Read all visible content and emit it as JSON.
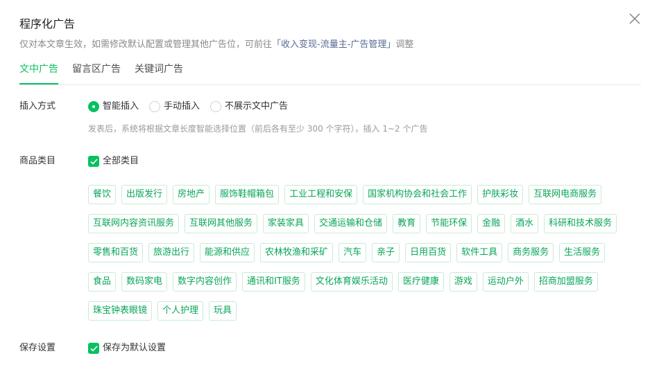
{
  "dialog": {
    "title": "程序化广告",
    "subtitle_prefix": "仅对本文章生效，如需修改默认配置或管理其他广告位，可前往",
    "subtitle_link": "「收入变现-流量主-广告管理」",
    "subtitle_suffix": "调整"
  },
  "tabs": [
    {
      "label": "文中广告",
      "active": true
    },
    {
      "label": "留言区广告",
      "active": false
    },
    {
      "label": "关键词广告",
      "active": false
    }
  ],
  "insert_mode": {
    "label": "插入方式",
    "options": [
      {
        "label": "智能插入",
        "selected": true
      },
      {
        "label": "手动插入",
        "selected": false
      },
      {
        "label": "不展示文中广告",
        "selected": false
      }
    ],
    "hint": "发表后，系统将根据文章长度智能选择位置（前后各有至少 300 个字符），插入 1~2 个广告"
  },
  "category": {
    "label": "商品类目",
    "all_label": "全部类目",
    "all_checked": true,
    "rows": [
      [
        "餐饮",
        "出版发行",
        "房地产",
        "服饰鞋帽箱包",
        "工业工程和安保",
        "国家机构协会和社会工作",
        "护肤彩妆",
        "互联网电商服务"
      ],
      [
        "互联网内容资讯服务",
        "互联网其他服务",
        "家装家具",
        "交通运输和仓储",
        "教育",
        "节能环保",
        "金融",
        "酒水",
        "科研和技术服务"
      ],
      [
        "零售和百货",
        "旅游出行",
        "能源和供应",
        "农林牧渔和采矿",
        "汽车",
        "亲子",
        "日用百货",
        "软件工具",
        "商务服务",
        "生活服务"
      ],
      [
        "食品",
        "数码家电",
        "数字内容创作",
        "通讯和IT服务",
        "文化体育娱乐活动",
        "医疗健康",
        "游戏",
        "运动户外",
        "招商加盟服务"
      ],
      [
        "珠宝钟表眼镜",
        "个人护理",
        "玩具"
      ]
    ]
  },
  "save": {
    "label": "保存设置",
    "checkbox_label": "保存为默认设置",
    "checked": true
  },
  "colors": {
    "accent": "#07c160",
    "link": "#576b95"
  }
}
